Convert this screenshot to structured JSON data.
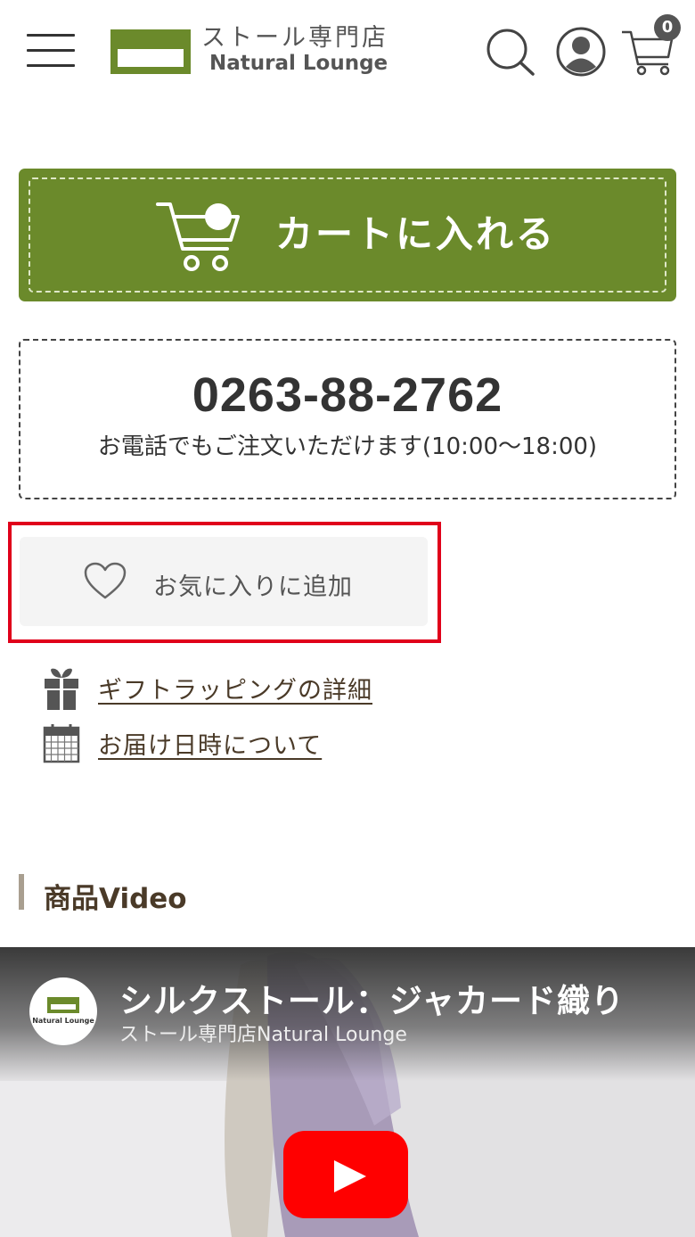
{
  "header": {
    "menu_icon": "hamburger-menu-icon",
    "logo_jp": "ストール専門店",
    "logo_en": "Natural Lounge",
    "search_icon": "search-icon",
    "account_icon": "user-icon",
    "cart_icon": "cart-icon",
    "cart_count": "0"
  },
  "purchase": {
    "add_to_cart_label": "カートに入れる",
    "add_to_cart_color": "#6b8a2b"
  },
  "phone": {
    "number": "0263-88-2762",
    "note": "お電話でもご注文いただけます(10:00〜18:00)"
  },
  "favorite": {
    "label": "お気に入りに追加",
    "icon": "heart-icon",
    "highlight_color": "#e0001a"
  },
  "links": [
    {
      "label": "ギフトラッピングの詳細",
      "icon": "gift-icon"
    },
    {
      "label": "お届け日時について",
      "icon": "calendar-icon"
    }
  ],
  "video_section": {
    "heading": "商品Video",
    "title": "シルクストール：ジャカード織り",
    "channel": "ストール専門店Natural Lounge",
    "channel_avatar_text": "Natural Lounge",
    "play_icon": "play-icon"
  }
}
